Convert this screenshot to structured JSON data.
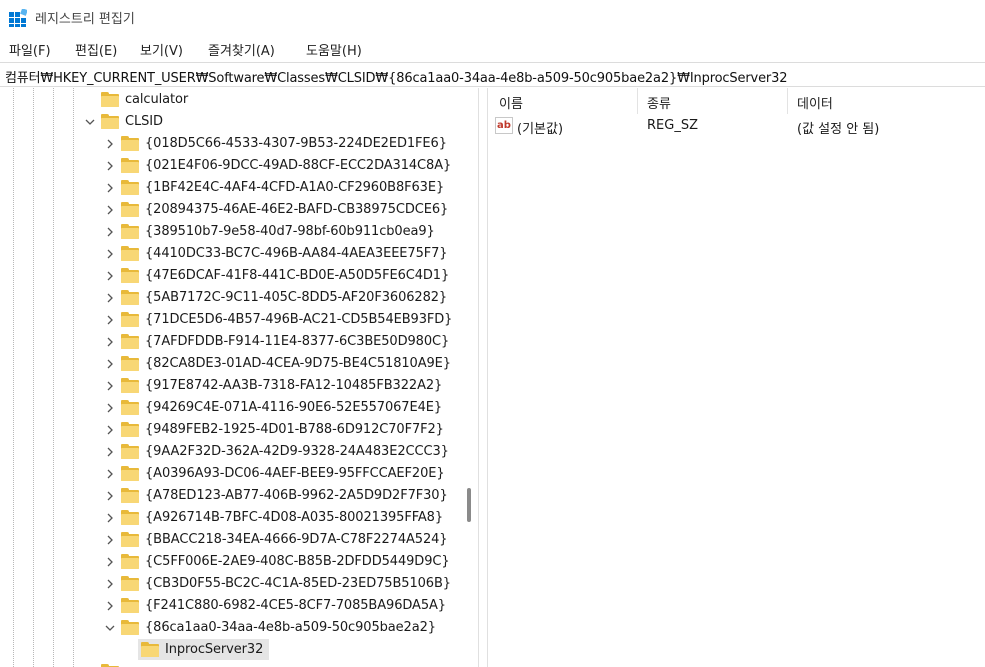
{
  "window": {
    "title": "레지스트리 편집기"
  },
  "menu": [
    "파일(F)",
    "편집(E)",
    "보기(V)",
    "즐겨찾기(A)",
    "도움말(H)"
  ],
  "address": "컴퓨터₩HKEY_CURRENT_USER₩Software₩Classes₩CLSID₩{86ca1aa0-34aa-4e8b-a509-50c905bae2a2}₩InprocServer32",
  "tree": {
    "calculator": "calculator",
    "clsid": "CLSID",
    "children": [
      "{018D5C66-4533-4307-9B53-224DE2ED1FE6}",
      "{021E4F06-9DCC-49AD-88CF-ECC2DA314C8A}",
      "{1BF42E4C-4AF4-4CFD-A1A0-CF2960B8F63E}",
      "{20894375-46AE-46E2-BAFD-CB38975CDCE6}",
      "{389510b7-9e58-40d7-98bf-60b911cb0ea9}",
      "{4410DC33-BC7C-496B-AA84-4AEA3EEE75F7}",
      "{47E6DCAF-41F8-441C-BD0E-A50D5FE6C4D1}",
      "{5AB7172C-9C11-405C-8DD5-AF20F3606282}",
      "{71DCE5D6-4B57-496B-AC21-CD5B54EB93FD}",
      "{7AFDFDDB-F914-11E4-8377-6C3BE50D980C}",
      "{82CA8DE3-01AD-4CEA-9D75-BE4C51810A9E}",
      "{917E8742-AA3B-7318-FA12-10485FB322A2}",
      "{94269C4E-071A-4116-90E6-52E557067E4E}",
      "{9489FEB2-1925-4D01-B788-6D912C70F7F2}",
      "{9AA2F32D-362A-42D9-9328-24A483E2CCC3}",
      "{A0396A93-DC06-4AEF-BEE9-95FFCCAEF20E}",
      "{A78ED123-AB77-406B-9962-2A5D9D2F7F30}",
      "{A926714B-7BFC-4D08-A035-80021395FFA8}",
      "{BBACC218-34EA-4666-9D7A-C78F2274A524}",
      "{C5FF006E-2AE9-408C-B85B-2DFDD5449D9C}",
      "{CB3D0F55-BC2C-4C1A-85ED-23ED75B5106B}",
      "{F241C880-6982-4CE5-8CF7-7085BA96DA5A}",
      "{86ca1aa0-34aa-4e8b-a509-50c905bae2a2}"
    ],
    "selected": "InprocServer32"
  },
  "list": {
    "columns": [
      "이름",
      "종류",
      "데이터"
    ],
    "rows": [
      {
        "name": "(기본값)",
        "type": "REG_SZ",
        "data": "(값 설정 안 됨)"
      }
    ]
  },
  "colors": {
    "folder": "#f8d775",
    "selection": "#e5e5e5",
    "icon_accent": "#0078d4"
  }
}
